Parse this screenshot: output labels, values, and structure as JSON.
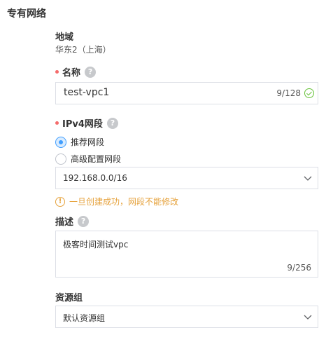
{
  "section": {
    "title": "专有网络"
  },
  "region": {
    "label": "地域",
    "value": "华东2（上海）"
  },
  "name": {
    "label": "名称",
    "help": "?",
    "value": "test-vpc1",
    "count": "9/128"
  },
  "ipv4": {
    "label": "IPv4网段",
    "help": "?",
    "options": [
      {
        "label": "推荐网段",
        "checked": true
      },
      {
        "label": "高级配置网段",
        "checked": false
      }
    ],
    "selected": "192.168.0.0/16",
    "warning": "一旦创建成功，网段不能修改",
    "warning_icon": "!"
  },
  "description": {
    "label": "描述",
    "help": "?",
    "value": "极客时间测试vpc",
    "count": "9/256"
  },
  "resource_group": {
    "label": "资源组",
    "selected": "默认资源组"
  },
  "colors": {
    "required": "#f56c6c",
    "accent": "#409eff",
    "warning": "#e6a23c",
    "success": "#67c23a"
  }
}
